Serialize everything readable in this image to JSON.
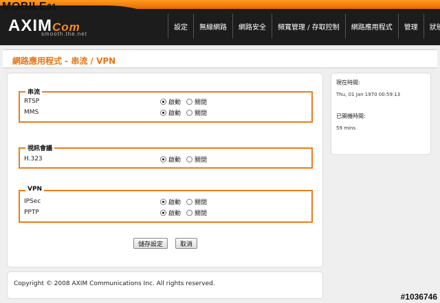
{
  "watermark": {
    "brand": "MOBILE01",
    "brand_main": "MOBILE",
    "brand_suffix": "01",
    "image_id": "#1036746"
  },
  "header": {
    "logo_main": "AXIM",
    "logo_com": "Com",
    "logo_sub": "smooth.the.net",
    "nav": [
      "設定",
      "無線網路",
      "網路安全",
      "頻寬管理 / 存取控制",
      "網路應用程式",
      "管理",
      "狀態"
    ]
  },
  "page_title": "網路應用程式 - 串流 / VPN",
  "sections": {
    "streaming": {
      "legend": "串流",
      "rows": [
        {
          "label": "RTSP",
          "enabled": true
        },
        {
          "label": "MMS",
          "enabled": true
        }
      ]
    },
    "video": {
      "legend": "視訊會議",
      "rows": [
        {
          "label": "H.323",
          "enabled": true
        }
      ]
    },
    "vpn": {
      "legend": "VPN",
      "rows": [
        {
          "label": "IPSec",
          "enabled": true
        },
        {
          "label": "PPTP",
          "enabled": true
        }
      ]
    }
  },
  "radio_labels": {
    "enable": "啟動",
    "disable": "關閉"
  },
  "buttons": {
    "save": "儲存設定",
    "cancel": "取消"
  },
  "status": {
    "current_time_label": "現在時間:",
    "current_time_value": "Thu, 01 Jan 1970 00:59:13",
    "uptime_label": "已開機時間:",
    "uptime_value": "59 mins"
  },
  "footer": {
    "copyright": "Copyright © 2008 AXIM Communications Inc. All rights reserved."
  }
}
